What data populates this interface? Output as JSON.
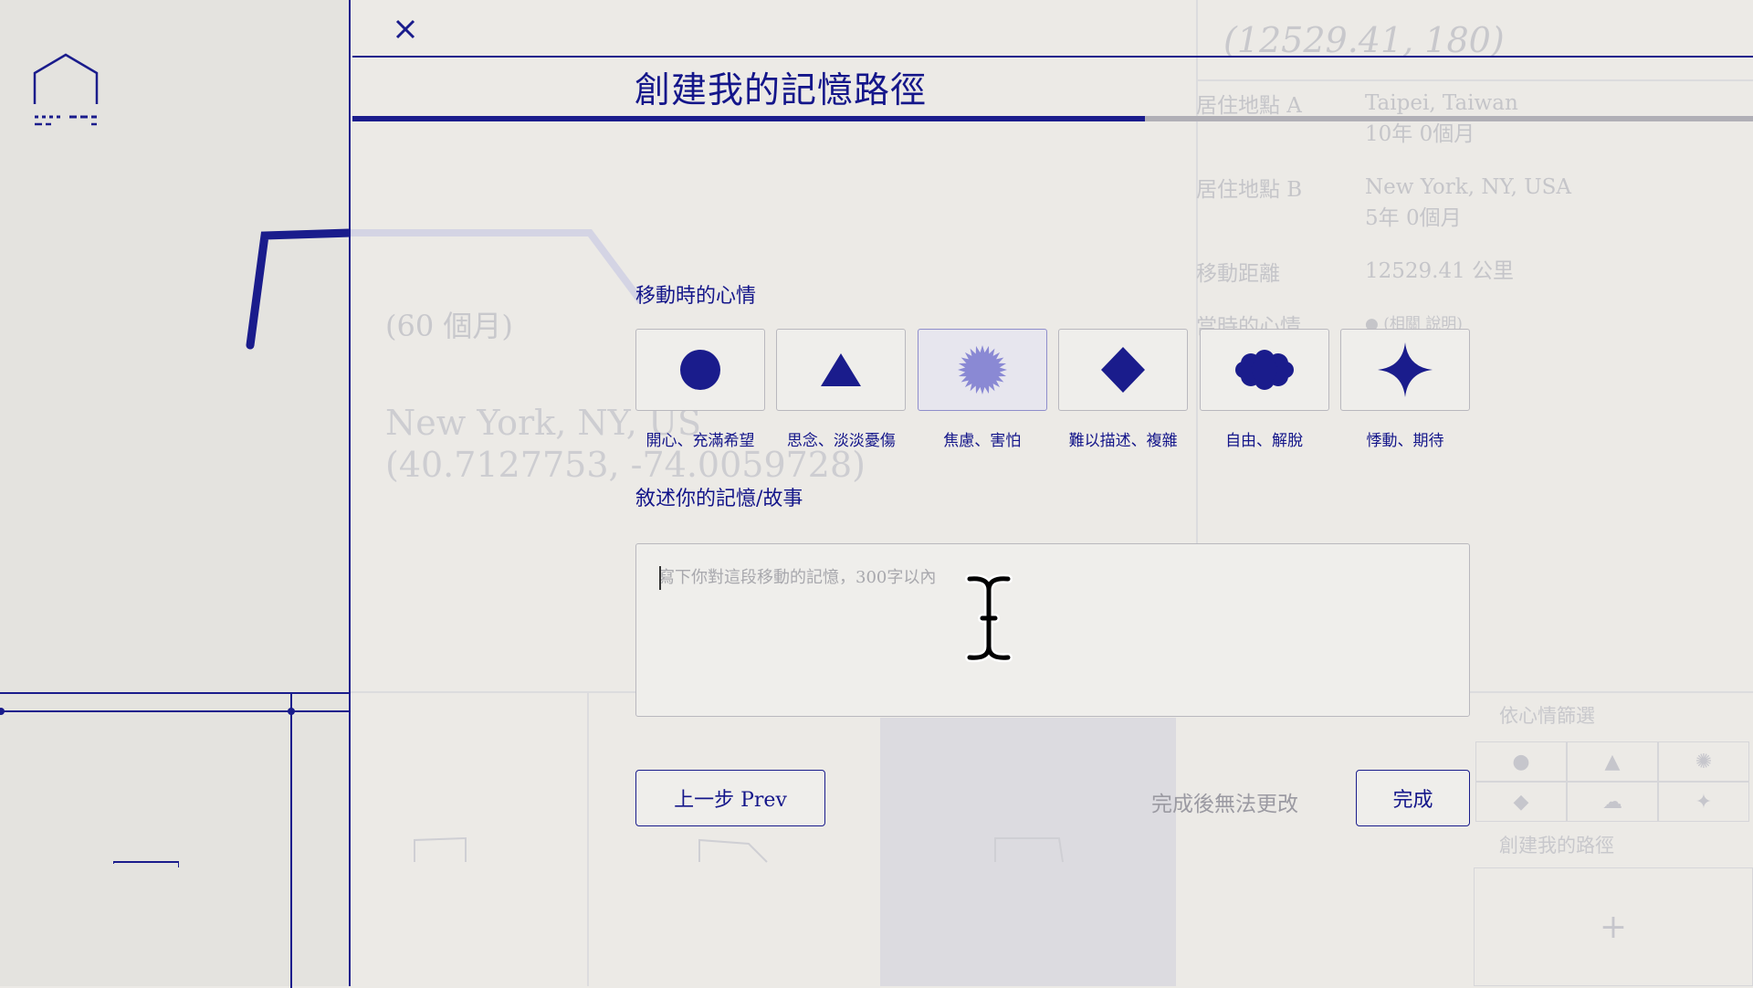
{
  "modal": {
    "title": "創建我的記憶路徑",
    "close_icon": "close-icon",
    "progress_fraction": 0.566
  },
  "mood": {
    "label": "移動時的心情",
    "options": [
      {
        "label": "開心、充滿希望",
        "icon": "circle-icon",
        "selected": false
      },
      {
        "label": "思念、淡淡憂傷",
        "icon": "triangle-icon",
        "selected": false
      },
      {
        "label": "焦慮、害怕",
        "icon": "starburst-icon",
        "selected": true
      },
      {
        "label": "難以描述、複雜",
        "icon": "diamond-icon",
        "selected": false
      },
      {
        "label": "自由、解脫",
        "icon": "cloud-icon",
        "selected": false
      },
      {
        "label": "悸動、期待",
        "icon": "sparkle-icon",
        "selected": false
      }
    ]
  },
  "story": {
    "label": "敘述你的記憶/故事",
    "placeholder": "寫下你對這段移動的記憶，300字以內",
    "value": ""
  },
  "footer": {
    "prev_label": "上一步 Prev",
    "locked_note": "完成後無法更改",
    "done_label": "完成"
  },
  "background": {
    "coordinate": "(12529.41, 180)",
    "info_rows": [
      {
        "key": "居住地點 A",
        "values": [
          "Taipei, Taiwan",
          "10年 0個月"
        ]
      },
      {
        "key": "居住地點 B",
        "values": [
          "New York, NY, USA",
          "5年 0個月"
        ]
      },
      {
        "key": "移動距離",
        "values": [
          "12529.41 公里"
        ]
      },
      {
        "key": "當時的心情",
        "values": [
          "● (相關   說明)"
        ]
      }
    ],
    "months": "(60 個月)",
    "city": "New York, NY, US",
    "city_coords": "(40.7127753, -74.0059728)",
    "grid_title": "依心情篩選",
    "grid_title2": "創建我的路徑",
    "plus": "+"
  },
  "colors": {
    "accent": "#1a1c8c",
    "background": "#eceae6",
    "selected_icon": "#8a89d4"
  }
}
